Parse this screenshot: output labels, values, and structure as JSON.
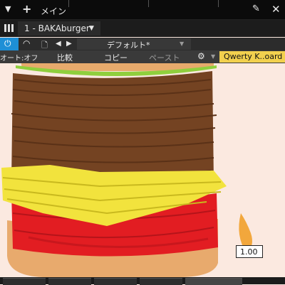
{
  "top_bar": {
    "menu_arrow": "chevron-down-icon",
    "add_icon": "plus-icon",
    "title": "メイン",
    "pin_icon": "pin-icon",
    "close_icon": "close-icon"
  },
  "track_bar": {
    "track_name": "1 - BAKAburger",
    "dropdown_icon": "chevron-down-icon"
  },
  "control_bar": {
    "preset_name": "デフォルト*",
    "power_icon": "power-icon",
    "accent": "#1e8fd6"
  },
  "control_bar2": {
    "auto_label": "オート:オフ",
    "compare_label": "比較",
    "copy_label": "コピー",
    "paste_label": "ペースト",
    "keyboard_label": "Qwerty K..oard",
    "keyboard_color": "#f2d04e"
  },
  "scene": {
    "value_box": "1.00"
  }
}
